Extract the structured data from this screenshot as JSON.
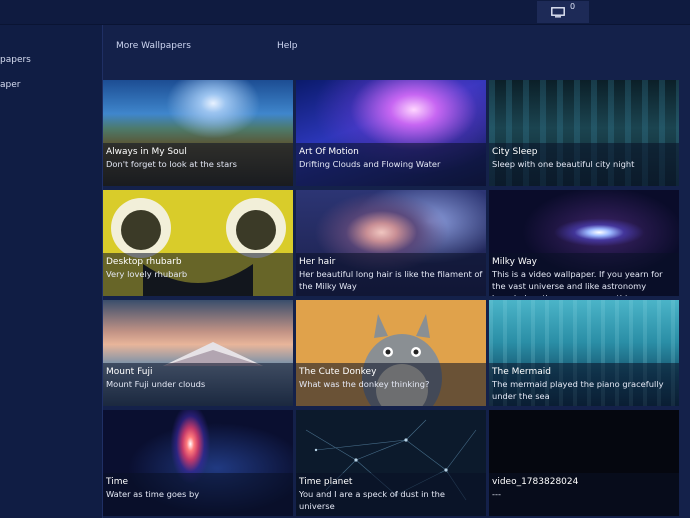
{
  "titlebar": {
    "monitor_icon": "monitor-icon",
    "monitor_count": "0"
  },
  "sidebar": {
    "items": [
      {
        "label": "papers"
      },
      {
        "label": "aper"
      }
    ]
  },
  "topnav": {
    "more_wallpapers": "More Wallpapers",
    "help": "Help"
  },
  "wallpapers": [
    {
      "title": "Always in My Soul",
      "desc": "Don't forget to look at the stars"
    },
    {
      "title": "Art Of Motion",
      "desc": "Drifting Clouds and Flowing Water"
    },
    {
      "title": "City Sleep",
      "desc": "Sleep with one beautiful city night"
    },
    {
      "title": "Desktop rhubarb",
      "desc": "Very lovely rhubarb"
    },
    {
      "title": "Her hair",
      "desc": "Her beautiful long hair is like the filament of the Milky Way"
    },
    {
      "title": "Milky Way",
      "desc": "This is a video wallpaper. If you yearn for the vast universe and like astronomy knowledge, then you can use this as your wallpaper"
    },
    {
      "title": "Mount Fuji",
      "desc": "Mount Fuji under clouds"
    },
    {
      "title": "The Cute Donkey",
      "desc": "What was the donkey thinking?"
    },
    {
      "title": "The Mermaid",
      "desc": "The mermaid played the piano gracefully under the sea"
    },
    {
      "title": "Time",
      "desc": "Water as time goes by"
    },
    {
      "title": "Time planet",
      "desc": "You and I are a speck of dust in the universe"
    },
    {
      "title": "video_1783828024",
      "desc": "---"
    }
  ]
}
